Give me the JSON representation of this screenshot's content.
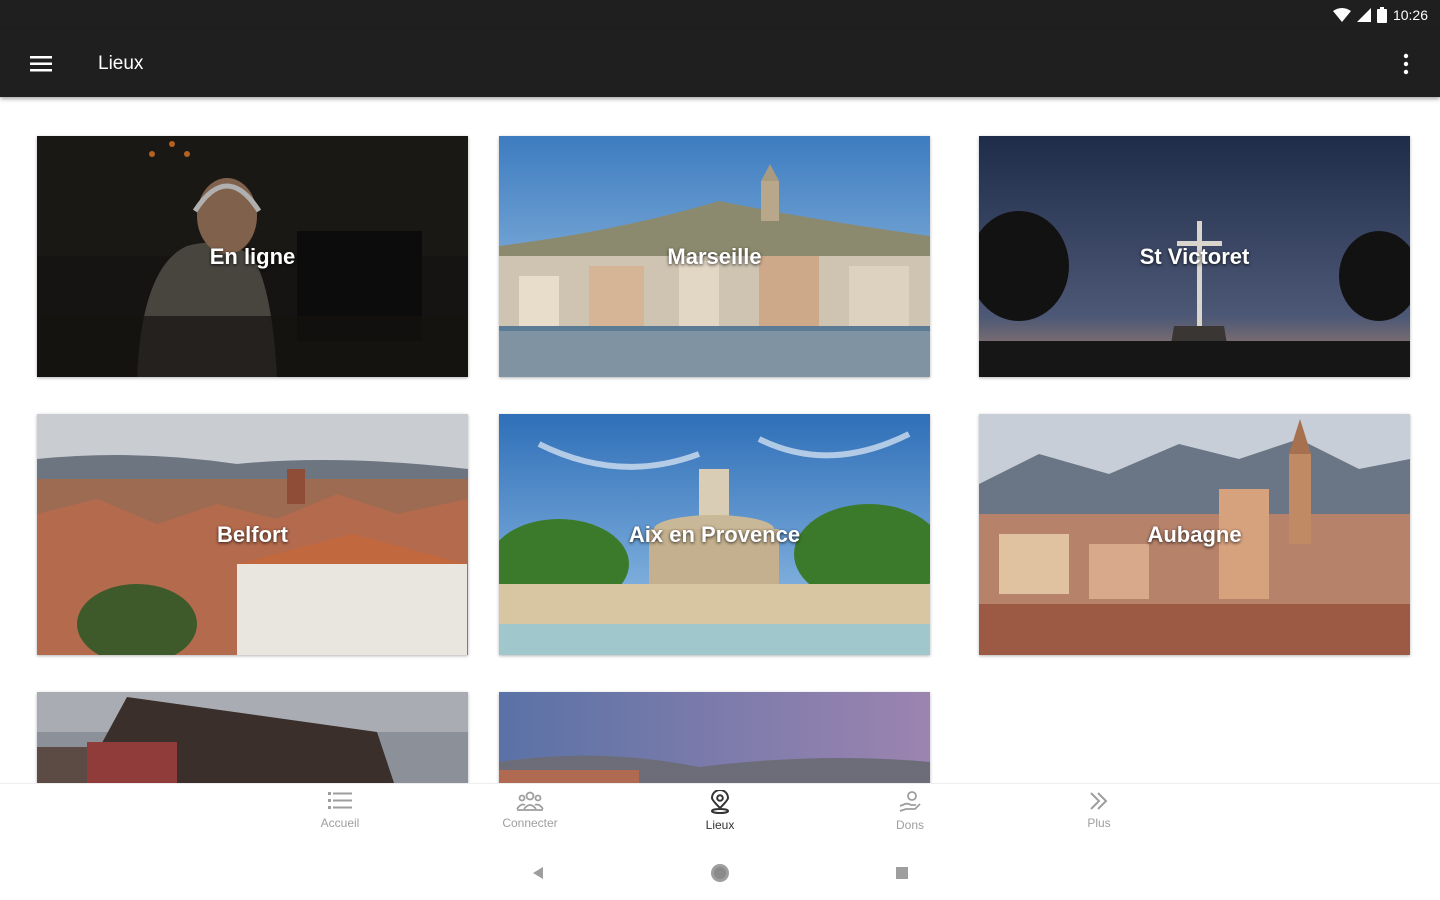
{
  "status_bar": {
    "time": "10:26",
    "icons": [
      "wifi-icon",
      "signal-icon",
      "battery-icon"
    ]
  },
  "app_bar": {
    "title": "Lieux",
    "menu_icon": "hamburger-menu-icon",
    "overflow_icon": "more-vert-icon"
  },
  "places": [
    {
      "name": "En ligne"
    },
    {
      "name": "Marseille"
    },
    {
      "name": "St Victoret"
    },
    {
      "name": "Belfort"
    },
    {
      "name": "Aix en Provence"
    },
    {
      "name": "Aubagne"
    },
    {
      "name": ""
    },
    {
      "name": ""
    }
  ],
  "bottom_nav": {
    "items": [
      {
        "label": "Accueil",
        "icon": "list-icon",
        "active": false
      },
      {
        "label": "Connecter",
        "icon": "group-icon",
        "active": false
      },
      {
        "label": "Lieux",
        "icon": "location-pin-icon",
        "active": true
      },
      {
        "label": "Dons",
        "icon": "donate-hand-icon",
        "active": false
      },
      {
        "label": "Plus",
        "icon": "double-chevron-right-icon",
        "active": false
      }
    ]
  },
  "system_nav": [
    "back-icon",
    "home-icon",
    "recents-icon"
  ],
  "colors": {
    "app_bar": "#1f1f1f",
    "nav_active": "#333333",
    "nav_inactive": "#9e9e9e"
  }
}
